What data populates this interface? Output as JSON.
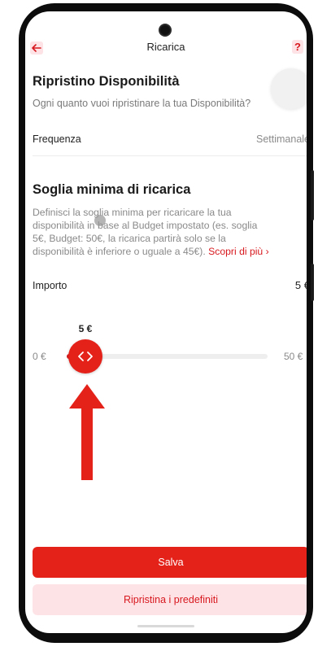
{
  "header": {
    "title": "Ricarica",
    "help_label": "?"
  },
  "restore": {
    "title": "Ripristino Disponibilità",
    "subtitle": "Ogni quanto vuoi ripristinare la tua Disponibilità?",
    "frequency_label": "Frequenza",
    "frequency_value": "Settimanale"
  },
  "threshold": {
    "title": "Soglia minima di ricarica",
    "description_lines": [
      "Definisci la soglia minima per ricaricare la tua",
      "disponibilità in base al Budget impostato (es. soglia",
      "5€, Budget: 50€, la ricarica partirà solo se la",
      "disponibilità è inferiore o uguale a 45€)."
    ],
    "link_label": "Scopri di più ›",
    "amount_label": "Importo",
    "amount_value": "5 €"
  },
  "slider": {
    "min_label": "0 €",
    "max_label": "50 €",
    "current_label": "5 €",
    "min": 0,
    "max": 50,
    "value": 5
  },
  "actions": {
    "save_label": "Salva",
    "reset_label": "Ripristina i predefiniti"
  },
  "colors": {
    "accent": "#e4221a",
    "accent_light": "#fde3e6",
    "text_muted": "#8a8a8a"
  },
  "icons": {
    "back": "arrow-left-icon",
    "help": "question-icon",
    "slider_thumb": "chevrons-left-right-icon",
    "annotation": "red-arrow-up-icon"
  }
}
